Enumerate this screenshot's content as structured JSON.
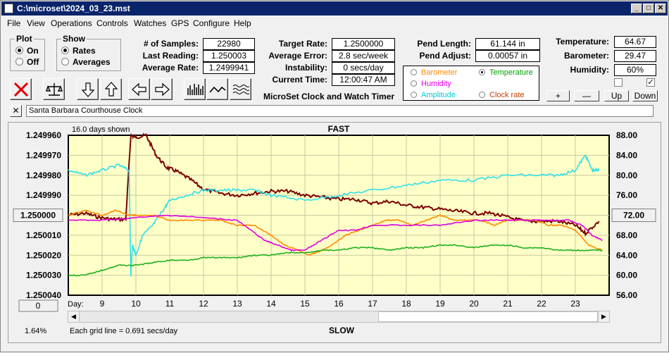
{
  "window": {
    "title": "C:\\microset\\2024_03_23.mst"
  },
  "menu": [
    "File",
    "View",
    "Operations",
    "Controls",
    "Watches",
    "GPS",
    "Configure",
    "Help"
  ],
  "plot_group": {
    "title": "Plot",
    "on": "On",
    "off": "Off",
    "selected": "On"
  },
  "show_group": {
    "title": "Show",
    "rates": "Rates",
    "averages": "Averages",
    "selected": "Rates"
  },
  "stats": {
    "samples_label": "# of Samples:",
    "samples": "22980",
    "last_reading_label": "Last Reading:",
    "last_reading": "1.250003",
    "average_rate_label": "Average Rate:",
    "average_rate": "1.2499941"
  },
  "targets": {
    "target_rate_label": "Target Rate:",
    "target_rate": "1.2500000",
    "average_error_label": "Average Error:",
    "average_error": "2.8 sec/week",
    "instability_label": "Instability:",
    "instability": "0 secs/day",
    "current_time_label": "Current Time:",
    "current_time": "12:00:47 AM",
    "product_name": "MicroSet Clock and Watch Timer"
  },
  "pendulum": {
    "length_label": "Pend Length:",
    "length": "61.144 in",
    "adjust_label": "Pend Adjust:",
    "adjust": "0.00057 in"
  },
  "environment": {
    "temperature_label": "Temperature:",
    "temperature": "64.67",
    "barometer_label": "Barometer:",
    "barometer": "29.47",
    "humidity_label": "Humidity:",
    "humidity": "60%",
    "check1": false,
    "check2": true
  },
  "selector": {
    "barometer": "Barometer",
    "temperature": "Temperature",
    "humidity": "Humidity",
    "amplitude": "Amplitude",
    "clock_rate": "Clock rate",
    "selected": "Temperature",
    "colors": {
      "barometer": "#ff8c00",
      "temperature": "#00a000",
      "humidity": "#e000e0",
      "amplitude": "#00c8d8",
      "clock_rate": "#c04000"
    }
  },
  "scale_buttons": {
    "plus": "+",
    "minus": "—",
    "up": "Up",
    "down": "Down"
  },
  "clock_name": "Santa Barbara Courthouse Clock",
  "chart_data": {
    "type": "line",
    "days_shown": "16.0 days shown",
    "top_label": "FAST",
    "bottom_label": "SLOW",
    "left_axis": [
      "1.249960",
      "1.249970",
      "1.249980",
      "1.249990",
      "1.250000",
      "1.250010",
      "1.250020",
      "1.250030",
      "1.250040"
    ],
    "left_center_button": "1.250000",
    "right_axis": [
      "88.00",
      "84.00",
      "80.00",
      "76.00",
      "72.00",
      "68.00",
      "64.00",
      "60.00",
      "56.00"
    ],
    "right_center_button": "72.00",
    "left_bottom_button": "0",
    "x_axis_title": "Day:",
    "x_ticks": [
      "9",
      "10",
      "11",
      "12",
      "13",
      "14",
      "15",
      "16",
      "17",
      "18",
      "19",
      "20",
      "21",
      "22",
      "23"
    ],
    "grid_note": "Each grid line = 0.691 secs/day",
    "percent": "1.64%",
    "ylim_rate": [
      1.24996,
      1.25004
    ],
    "ylim_env": [
      56,
      88
    ],
    "series": [
      {
        "name": "Clock rate",
        "color": "#7a0000",
        "axis": "rate",
        "x": [
          8.0,
          8.5,
          8.9,
          9.3,
          9.7,
          9.85,
          10.0,
          10.3,
          10.6,
          10.9,
          11.2,
          11.6,
          12.0,
          12.5,
          13.0,
          13.5,
          14.0,
          14.5,
          15.0,
          15.5,
          16.0,
          16.5,
          17.0,
          17.5,
          18.0,
          18.5,
          19.0,
          19.5,
          20.0,
          20.5,
          21.0,
          21.5,
          22.0,
          22.5,
          23.0,
          23.3,
          23.7
        ],
        "y": [
          1.25,
          1.249999,
          1.250001,
          1.250002,
          1.250002,
          1.24996,
          1.249961,
          1.24996,
          1.24997,
          1.249976,
          1.249978,
          1.249982,
          1.249987,
          1.249989,
          1.24999,
          1.249989,
          1.249988,
          1.249988,
          1.24999,
          1.249991,
          1.249992,
          1.249992,
          1.249994,
          1.249993,
          1.249995,
          1.249996,
          1.249997,
          1.249998,
          1.249999,
          1.249999,
          1.250001,
          1.250003,
          1.250003,
          1.250003,
          1.250005,
          1.250009,
          1.250003
        ]
      },
      {
        "name": "Amplitude",
        "color": "#30e0e8",
        "axis": "env",
        "x": [
          8.0,
          8.5,
          9.0,
          9.5,
          9.8,
          9.85,
          9.9,
          10.0,
          10.2,
          10.5,
          10.8,
          11.0,
          11.5,
          12.0,
          12.5,
          13.0,
          13.5,
          14.0,
          15.0,
          16.0,
          17.0,
          18.0,
          19.0,
          20.0,
          21.0,
          22.0,
          22.5,
          23.0,
          23.3,
          23.5,
          23.7
        ],
        "y": [
          81,
          80,
          81,
          82,
          81,
          60,
          66,
          64,
          68,
          70,
          73,
          75,
          76,
          77,
          77,
          77,
          77,
          76,
          75,
          76,
          77,
          78,
          79,
          79,
          80,
          80,
          80,
          81,
          84,
          81,
          81
        ]
      },
      {
        "name": "Barometer",
        "color": "#ff8c00",
        "axis": "env",
        "x": [
          8.0,
          8.5,
          9.0,
          9.4,
          9.8,
          10.0,
          10.5,
          11.0,
          11.5,
          12.0,
          12.5,
          13.0,
          13.5,
          14.0,
          14.4,
          14.8,
          15.1,
          15.5,
          15.8,
          16.2,
          16.6,
          17.0,
          17.4,
          17.8,
          18.2,
          18.6,
          19.0,
          19.4,
          19.8,
          20.2,
          20.6,
          21.0,
          21.4,
          21.8,
          22.2,
          22.6,
          23.0,
          23.4,
          23.8
        ],
        "y": [
          72,
          73,
          72,
          73,
          72,
          72,
          72,
          71,
          71,
          71,
          71,
          70,
          70,
          68,
          66,
          65,
          64,
          65,
          66,
          68,
          69,
          70,
          71,
          71,
          70,
          71,
          72,
          71,
          71,
          71,
          70,
          71,
          71,
          71,
          70,
          70,
          69,
          66,
          65
        ]
      },
      {
        "name": "Humidity",
        "color": "#e000e0",
        "axis": "env",
        "x": [
          8.0,
          9.0,
          10.0,
          11.0,
          12.0,
          13.0,
          13.4,
          13.8,
          14.2,
          14.6,
          15.0,
          15.5,
          16.0,
          16.5,
          17.0,
          18.0,
          19.0,
          20.0,
          21.0,
          22.0,
          22.8,
          23.2,
          23.5,
          23.8
        ],
        "y": [
          71,
          71,
          71.5,
          72,
          71.5,
          71,
          69,
          67,
          66,
          65,
          65,
          67,
          69,
          69,
          70,
          70,
          70,
          71,
          71,
          71,
          71,
          70,
          68,
          67
        ]
      },
      {
        "name": "Temperature",
        "color": "#20b020",
        "axis": "env",
        "x": [
          8.0,
          8.5,
          9.0,
          9.5,
          10.0,
          10.5,
          11.0,
          11.5,
          12.0,
          12.5,
          13.0,
          13.5,
          14.0,
          14.5,
          15.0,
          15.5,
          16.0,
          16.5,
          17.0,
          17.5,
          18.0,
          18.5,
          19.0,
          19.5,
          20.0,
          20.5,
          21.0,
          21.5,
          22.0,
          22.5,
          23.0,
          23.5,
          23.8
        ],
        "y": [
          60,
          60,
          61,
          62,
          62,
          62.5,
          63,
          63,
          63.5,
          63.5,
          63.5,
          64,
          64,
          64.5,
          64.5,
          65,
          65,
          65.5,
          65.5,
          65,
          65.5,
          65.5,
          66,
          66,
          65.5,
          66,
          66,
          65.5,
          65.5,
          65,
          65,
          65,
          65
        ]
      }
    ]
  }
}
